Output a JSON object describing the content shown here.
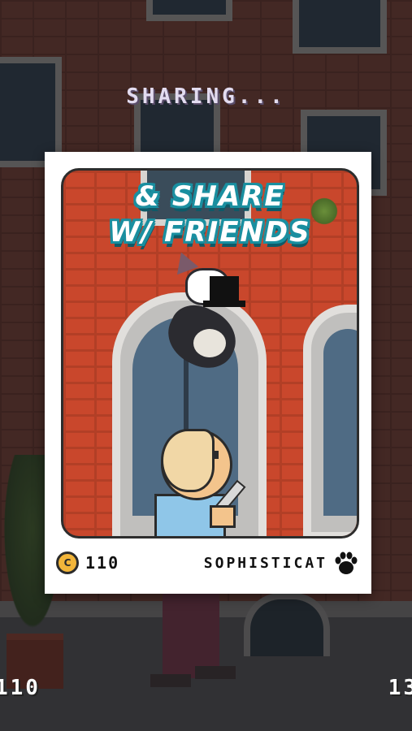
{
  "status": {
    "text": "SHARING..."
  },
  "card": {
    "title_line1": "& SHARE",
    "title_line2": "W/ FRIENDS",
    "coin_value": "110",
    "coin_symbol": "C",
    "cat_name": "SOPHISTICAT",
    "paw_icon": "paw-icon",
    "coin_icon": "coin-icon"
  },
  "hud": {
    "score_left": "110",
    "score_right": "13"
  },
  "colors": {
    "card_bg": "#ffffff",
    "title_outline": "#1a8fa0",
    "brick": "#c9472c",
    "coin": "#f2b53a",
    "status_text": "#e3dcf0"
  }
}
